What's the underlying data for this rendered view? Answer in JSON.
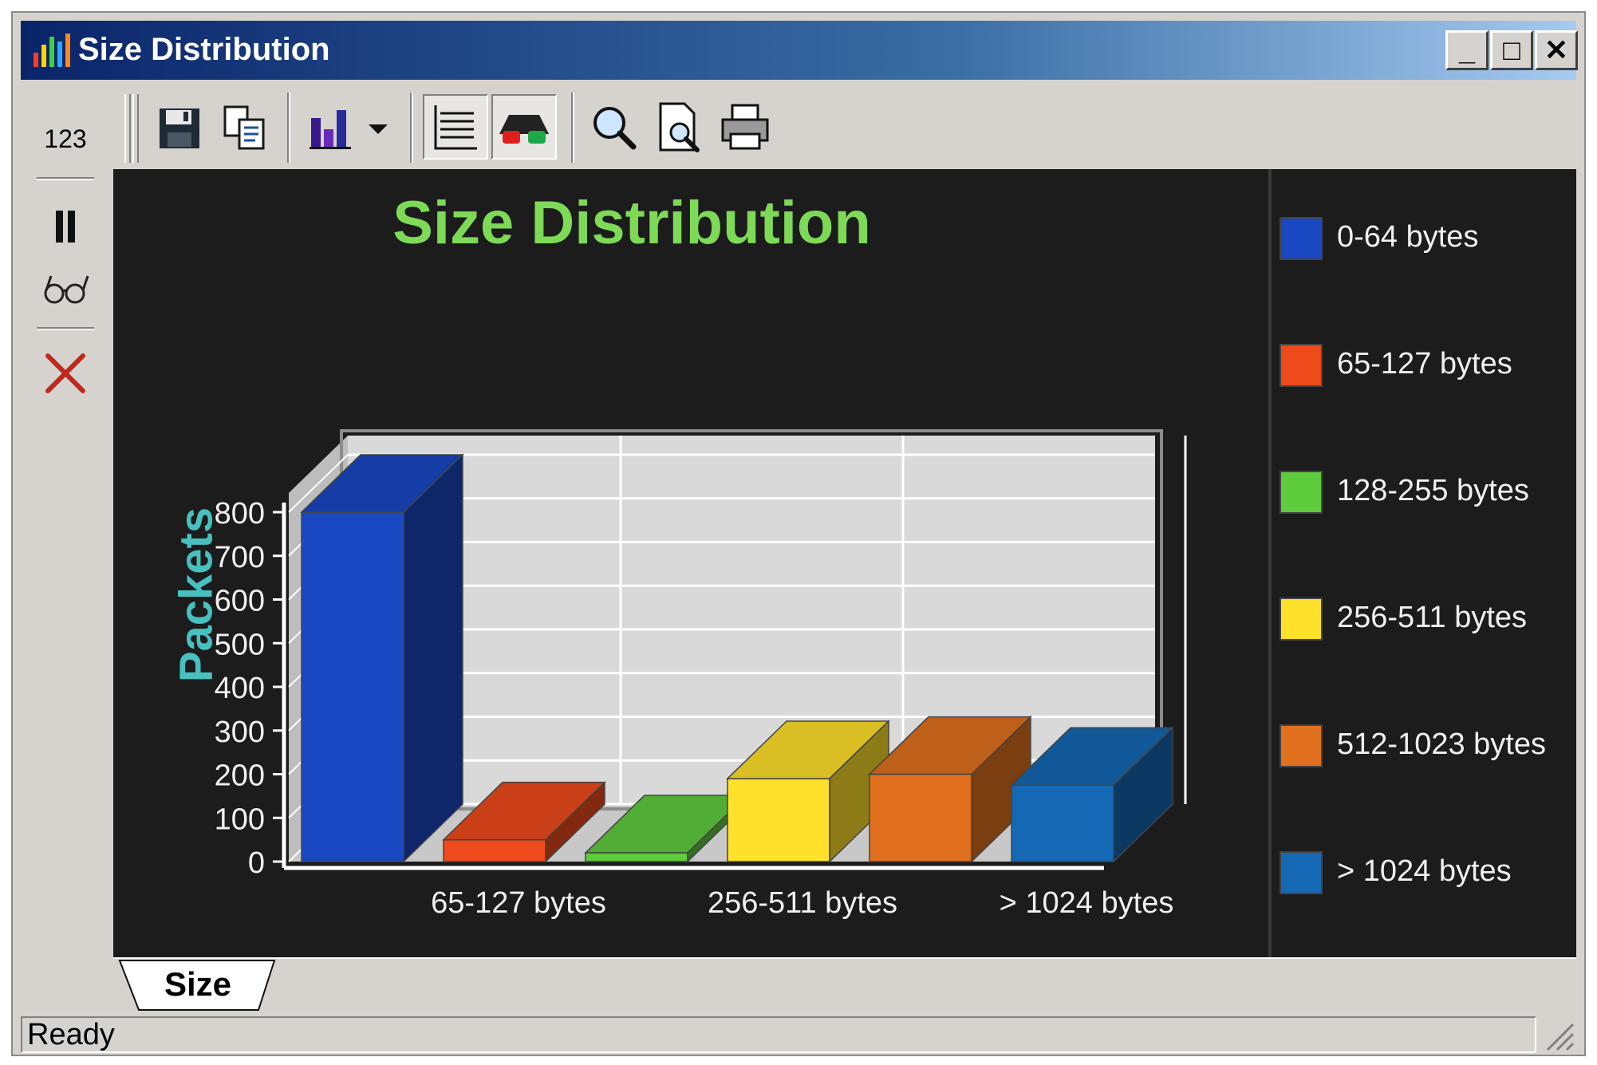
{
  "window": {
    "title": "Size Distribution",
    "min_glyph": "_",
    "max_glyph": "□",
    "close_glyph": "✕"
  },
  "left_toolbar": {
    "counter_label": "123"
  },
  "tabs": [
    {
      "label": "Size",
      "active": true
    }
  ],
  "status": {
    "text": "Ready"
  },
  "colors": {
    "title_green": "#7ed957",
    "ylabel_teal": "#48c0c0",
    "panel_bg": "#1c1c1c"
  },
  "chart_data": {
    "type": "bar",
    "title": "Size Distribution",
    "ylabel": "Packets",
    "xlabel": "",
    "ylim": [
      0,
      800
    ],
    "yticks": [
      0,
      100,
      200,
      300,
      400,
      500,
      600,
      700,
      800
    ],
    "categories": [
      "0-64 bytes",
      "65-127 bytes",
      "128-255 bytes",
      "256-511 bytes",
      "512-1023 bytes",
      "> 1024 bytes"
    ],
    "x_tick_labels": [
      "65-127 bytes",
      "256-511 bytes",
      "> 1024 bytes"
    ],
    "values": [
      800,
      50,
      20,
      190,
      200,
      175
    ],
    "colors": [
      "#1a47c2",
      "#ee4a1c",
      "#5fcc3e",
      "#ffe02a",
      "#e0701e",
      "#1468b4"
    ],
    "grid": true,
    "legend": "right",
    "style": "3d"
  }
}
